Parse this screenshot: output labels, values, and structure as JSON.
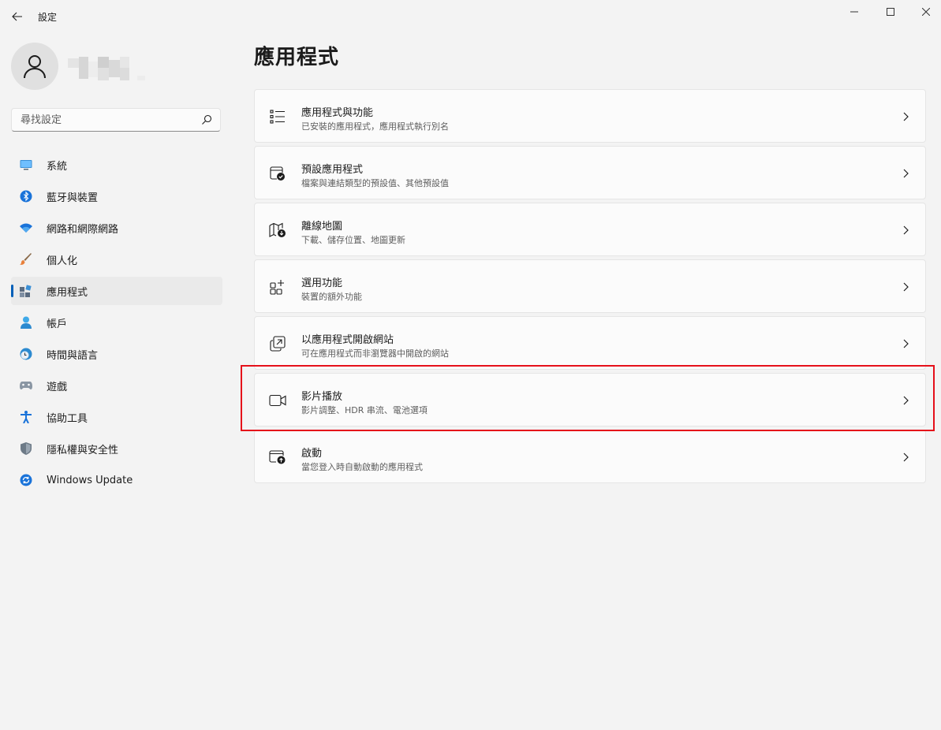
{
  "window": {
    "title": "設定"
  },
  "search": {
    "placeholder": "尋找設定"
  },
  "sidebar": {
    "items": [
      {
        "label": "系統",
        "icon": "monitor-icon"
      },
      {
        "label": "藍牙與裝置",
        "icon": "bluetooth-icon"
      },
      {
        "label": "網路和網際網路",
        "icon": "wifi-icon"
      },
      {
        "label": "個人化",
        "icon": "paintbrush-icon"
      },
      {
        "label": "應用程式",
        "icon": "apps-icon",
        "selected": true
      },
      {
        "label": "帳戶",
        "icon": "person-icon"
      },
      {
        "label": "時間與語言",
        "icon": "globe-clock-icon"
      },
      {
        "label": "遊戲",
        "icon": "gamepad-icon"
      },
      {
        "label": "協助工具",
        "icon": "accessibility-icon"
      },
      {
        "label": "隱私權與安全性",
        "icon": "shield-icon"
      },
      {
        "label": "Windows Update",
        "icon": "update-icon"
      }
    ]
  },
  "main": {
    "title": "應用程式",
    "cards": [
      {
        "title": "應用程式與功能",
        "subtitle": "已安裝的應用程式，應用程式執行別名",
        "icon": "list-icon"
      },
      {
        "title": "預設應用程式",
        "subtitle": "檔案與連結類型的預設值、其他預設值",
        "icon": "default-apps-icon"
      },
      {
        "title": "離線地圖",
        "subtitle": "下載、儲存位置、地圖更新",
        "icon": "map-download-icon"
      },
      {
        "title": "選用功能",
        "subtitle": "裝置的額外功能",
        "icon": "add-grid-icon"
      },
      {
        "title": "以應用程式開啟網站",
        "subtitle": "可在應用程式而非瀏覽器中開啟的網站",
        "icon": "open-external-icon"
      },
      {
        "title": "影片播放",
        "subtitle": "影片調整、HDR 串流、電池選項",
        "icon": "video-camera-icon",
        "highlighted": true
      },
      {
        "title": "啟動",
        "subtitle": "當您登入時自動啟動的應用程式",
        "icon": "startup-icon"
      }
    ]
  },
  "colors": {
    "accent": "#005fb8",
    "highlight_border": "#e5101a",
    "background": "#f3f3f3",
    "card": "#fbfbfb"
  }
}
